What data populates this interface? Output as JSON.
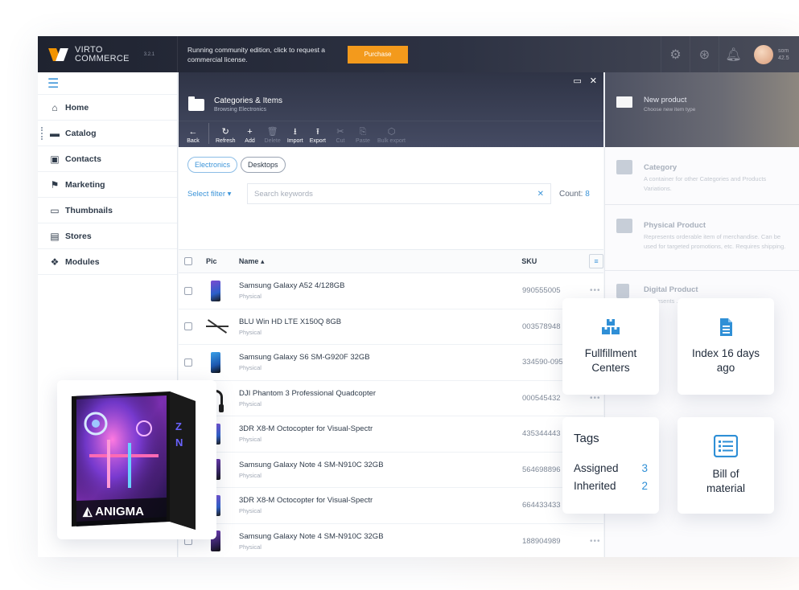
{
  "topbar": {
    "brand_line1": "VIRTO",
    "brand_line2": "COMMERCE",
    "version": "3.2.1",
    "notice": "Running community edition, click to request a commercial license.",
    "purchase_label": "Purchase",
    "user_line1": "som",
    "user_line2": "42.5",
    "icons": [
      "gear-icon",
      "lifebuoy-icon",
      "bell-icon"
    ]
  },
  "sidebar": {
    "items": [
      {
        "label": "Home",
        "icon": "home-icon"
      },
      {
        "label": "Catalog",
        "icon": "folder-icon"
      },
      {
        "label": "Contacts",
        "icon": "contact-card-icon"
      },
      {
        "label": "Marketing",
        "icon": "flag-icon"
      },
      {
        "label": "Thumbnails",
        "icon": "image-icon"
      },
      {
        "label": "Stores",
        "icon": "store-icon"
      },
      {
        "label": "Modules",
        "icon": "cubes-icon"
      }
    ]
  },
  "blade": {
    "title": "Categories & Items",
    "subtitle": "Browsing Electronics",
    "toolbar": [
      {
        "label": "Back",
        "glyph": "←",
        "enabled": true
      },
      {
        "label": "Refresh",
        "glyph": "↻",
        "enabled": true
      },
      {
        "label": "Add",
        "glyph": "+",
        "enabled": true
      },
      {
        "label": "Delete",
        "glyph": "🗑",
        "enabled": false
      },
      {
        "label": "Import",
        "glyph": "⭳",
        "enabled": true
      },
      {
        "label": "Export",
        "glyph": "⭱",
        "enabled": true
      },
      {
        "label": "Cut",
        "glyph": "✂",
        "enabled": false
      },
      {
        "label": "Paste",
        "glyph": "⎘",
        "enabled": false
      },
      {
        "label": "Bulk export",
        "glyph": "⬡",
        "enabled": false
      }
    ],
    "breadcrumbs": [
      "Electronics",
      "Desktops"
    ],
    "filter_label": "Select filter",
    "search_placeholder": "Search keywords",
    "count_label": "Count:",
    "count_value": "8",
    "columns": {
      "pic": "Pic",
      "name": "Name",
      "sku": "SKU"
    },
    "rows": [
      {
        "name": "Samsung Galaxy A52 4/128GB",
        "type": "Physical",
        "sku": "990555005",
        "pic": "phone"
      },
      {
        "name": "BLU Win HD LTE X150Q 8GB",
        "type": "Physical",
        "sku": "003578948",
        "pic": "drone"
      },
      {
        "name": "Samsung Galaxy S6 SM-G920F 32GB",
        "type": "Physical",
        "sku": "334590-095",
        "pic": "phone-blue"
      },
      {
        "name": "DJI Phantom 3 Professional Quadcopter",
        "type": "Physical",
        "sku": "000545432",
        "pic": "headphones"
      },
      {
        "name": "3DR X8-M Octocopter for Visual-Spectr",
        "type": "Physical",
        "sku": "435344443",
        "pic": "phone"
      },
      {
        "name": "Samsung Galaxy Note 4 SM-N910C 32GB",
        "type": "Physical",
        "sku": "564698896",
        "pic": "dark"
      },
      {
        "name": "3DR X8-M Octocopter for Visual-Spectr",
        "type": "Physical",
        "sku": "664433433",
        "pic": "phone"
      },
      {
        "name": "Samsung Galaxy Note 4 SM-N910C 32GB",
        "type": "Physical",
        "sku": "188904989",
        "pic": "dark"
      }
    ]
  },
  "new_product": {
    "title": "New product",
    "subtitle": "Choose new item type",
    "items": [
      {
        "name": "Category",
        "desc": "A container for other Categories and Products Variations."
      },
      {
        "name": "Physical Product",
        "desc": "Represents orderable item of merchandise. Can be used for targeted promotions, etc. Requires shipping."
      },
      {
        "name": "Digital Product",
        "desc": "Represents ... used to ... ds dow..."
      }
    ]
  },
  "cards": {
    "fulfillment": "Fullfillment Centers",
    "index": "Index 16 days ago",
    "tags_title": "Tags",
    "assigned_label": "Assigned",
    "assigned_value": "3",
    "inherited_label": "Inherited",
    "inherited_value": "2",
    "bom": "Bill of material",
    "pc_brand": "ANIGMA"
  },
  "colors": {
    "accent": "#3d95d9",
    "purchase": "#f39a1c",
    "topbar": "#1f2330"
  }
}
